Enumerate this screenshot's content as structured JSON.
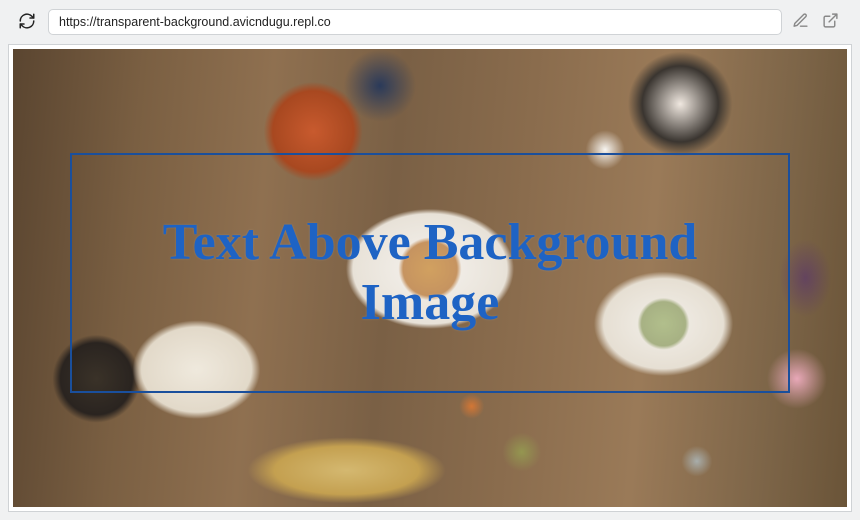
{
  "toolbar": {
    "url": "https://transparent-background.avicndugu.repl.co"
  },
  "page": {
    "overlay_heading": "Text Above Background Image"
  },
  "colors": {
    "overlay_border": "#1a4f9c",
    "overlay_text": "#1e63c4"
  }
}
